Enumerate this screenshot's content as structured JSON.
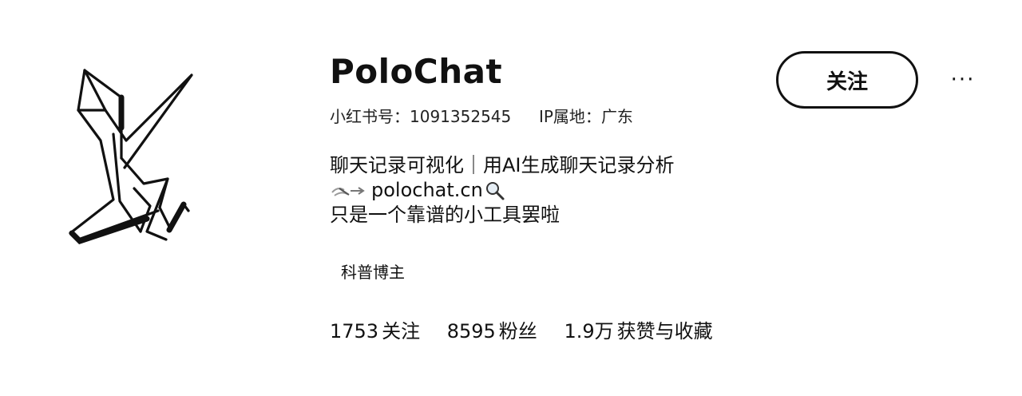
{
  "profile": {
    "name": "PoloChat",
    "id_label": "小红书号：",
    "id_value": "1091352545",
    "ip_label": "IP属地：",
    "ip_value": "广东",
    "bio_line1": "聊天记录可视化｜用AI生成聊天记录分析",
    "bio_link": "polochat.cn",
    "bio_line3": "只是一个靠谱的小工具罢啦",
    "tag": "科普博主",
    "avatar_icon": "paper-crane-icon"
  },
  "actions": {
    "follow_label": "关注",
    "more_label": "···"
  },
  "stats": [
    {
      "num": "1753",
      "label": "关注"
    },
    {
      "num": "8595",
      "label": "粉丝"
    },
    {
      "num": "1.9万",
      "label": "获赞与收藏"
    }
  ],
  "colors": {
    "text": "#111111",
    "background": "#ffffff"
  }
}
